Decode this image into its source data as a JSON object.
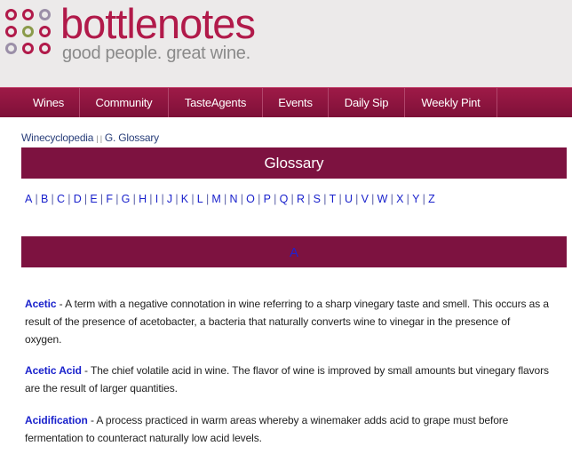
{
  "header": {
    "logo_text": "bottlenotes",
    "tagline": "good people. great wine.",
    "logo_dot_colors": [
      "#b11a4a",
      "#9b8fa8",
      "#b11a4a",
      "#9b8fa8",
      "#8a9a4a",
      "#b11a4a",
      "#b11a4a",
      "#9b8fa8",
      "#b11a4a"
    ]
  },
  "nav": {
    "items": [
      "Wines",
      "Community",
      "TasteAgents",
      "Events",
      "Daily Sip",
      "Weekly Pint"
    ]
  },
  "breadcrumb": {
    "root": "Winecyclopedia",
    "separator": "| |",
    "current": "G. Glossary"
  },
  "title": "Glossary",
  "alphabet": [
    "A",
    "B",
    "C",
    "D",
    "E",
    "F",
    "G",
    "H",
    "I",
    "J",
    "K",
    "L",
    "M",
    "N",
    "O",
    "P",
    "Q",
    "R",
    "S",
    "T",
    "U",
    "V",
    "W",
    "X",
    "Y",
    "Z"
  ],
  "section": {
    "letter": "A"
  },
  "entries": [
    {
      "term": "Acetic",
      "definition": " - A term with a negative connotation in wine referring to a sharp vinegary taste and smell. This occurs as a result of the presence of acetobacter, a bacteria that naturally converts wine to vinegar in the presence of oxygen."
    },
    {
      "term": "Acetic Acid",
      "definition": " - The chief volatile acid in wine. The flavor of wine is improved by small amounts but vinegary flavors are the result of larger quantities."
    },
    {
      "term": "Acidification",
      "definition": " - A process practiced in warm areas whereby a winemaker adds acid to grape must before fermentation to counteract naturally low acid levels."
    }
  ],
  "colors": {
    "brand": "#b11a4a",
    "bar": "#7d1240",
    "link": "#1a22cc"
  }
}
